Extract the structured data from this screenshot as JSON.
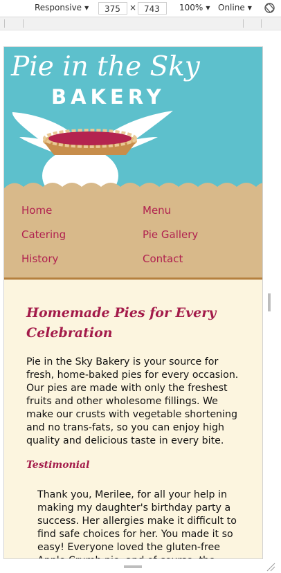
{
  "devtools": {
    "device": "Responsive",
    "width": "375",
    "times": "×",
    "height": "743",
    "zoom": "100%",
    "network": "Online"
  },
  "site": {
    "logo_script": "Pie in the Sky",
    "logo_bakery": "BAKERY",
    "nav": [
      {
        "label": "Home"
      },
      {
        "label": "Menu"
      },
      {
        "label": "Catering"
      },
      {
        "label": "Pie Gallery"
      },
      {
        "label": "History"
      },
      {
        "label": "Contact"
      }
    ],
    "heading": "Homemade Pies for Every Celebration",
    "paragraph": "Pie in the Sky Bakery is your source for fresh, home-baked pies for every occasion. Our pies are made with only the freshest fruits and other wholesome fillings. We make our crusts with vegetable shortening and no trans-fats, so you can enjoy high quality and delicious taste in every bite.",
    "testimonial_heading": "Testimonial",
    "testimonial": "Thank you, Merilee, for all your help in making my daughter's birthday party a success. Her allergies make it difficult to find safe choices for her. You made it so easy! Everyone loved the gluten-free Apple Crumb pie, and of course, the"
  },
  "colors": {
    "sky": "#5dc0cc",
    "nav_bg": "#d8b98a",
    "accent": "#a31b4a",
    "content_bg": "#fcf5df"
  }
}
